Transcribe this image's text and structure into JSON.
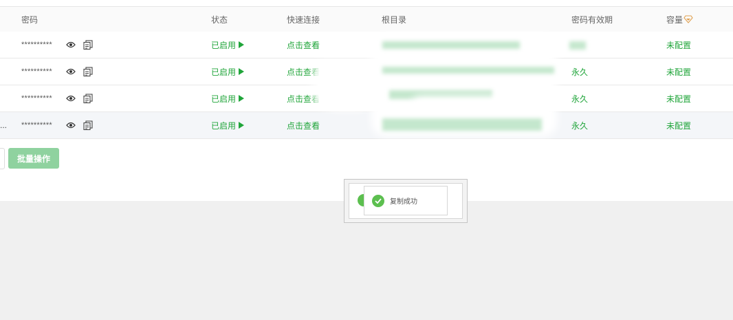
{
  "table": {
    "columns": {
      "password": "密码",
      "status": "状态",
      "quick_connect": "快速连接",
      "root_dir": "根目录",
      "expiry": "密码有效期",
      "capacity": "容量"
    },
    "rows": [
      {
        "password": "**********",
        "status": "已启用",
        "quick_connect": "点击查看",
        "expiry": "",
        "capacity": "未配置"
      },
      {
        "password": "**********",
        "status": "已启用",
        "quick_connect": "点击查看",
        "expiry": "永久",
        "capacity": "未配置"
      },
      {
        "password": "**********",
        "status": "已启用",
        "quick_connect": "点击查看",
        "expiry": "永久",
        "capacity": "未配置"
      },
      {
        "lead": "...",
        "password": "**********",
        "status": "已启用",
        "quick_connect": "点击查看",
        "expiry": "永久",
        "capacity": "未配置"
      }
    ]
  },
  "batch_button": "批量操作",
  "toast": {
    "message": "复制成功"
  },
  "icons": {
    "show_password": "eye-icon",
    "copy_password": "copy-icon",
    "status": "play-icon",
    "capacity_header": "vip-diamond-icon",
    "toast": "check-circle-icon"
  },
  "colors": {
    "accent_green": "#20a53a",
    "button_green": "#8fd29f",
    "toast_check": "#5cbf4f",
    "vip_orange": "#e0a050"
  }
}
